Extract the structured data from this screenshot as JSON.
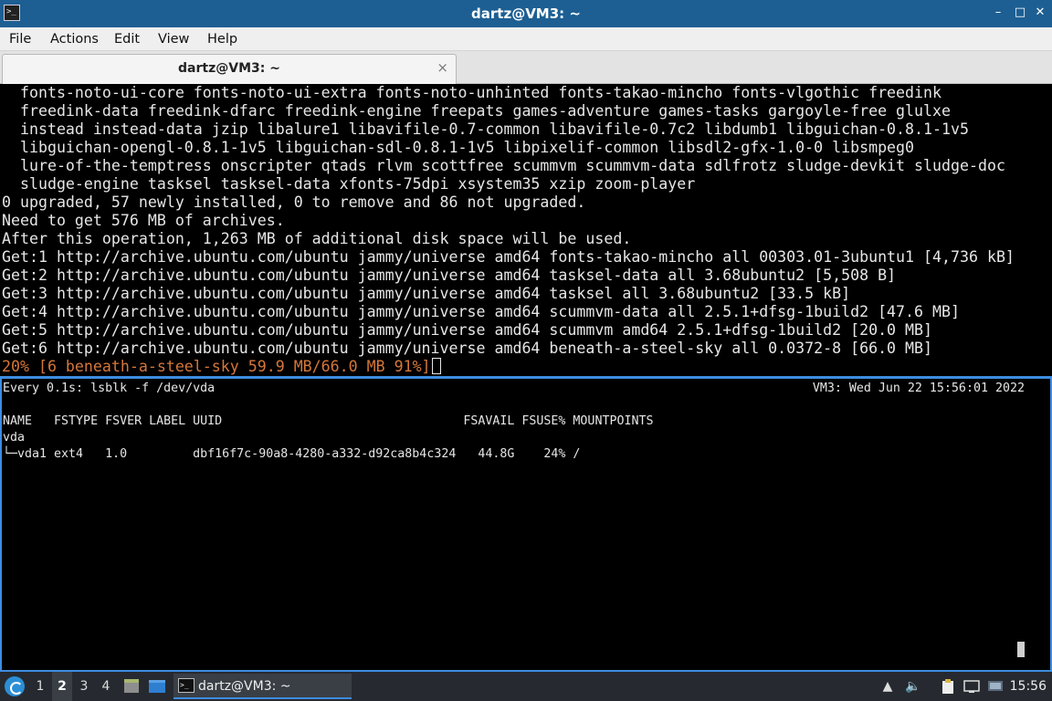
{
  "window": {
    "title": "dartz@VM3: ~",
    "minimize_glyph": "–",
    "maximize_glyph": "□",
    "close_glyph": "✕"
  },
  "menu": [
    "File",
    "Actions",
    "Edit",
    "View",
    "Help"
  ],
  "tab": {
    "label": "dartz@VM3: ~",
    "close_glyph": "×"
  },
  "terminal_top": {
    "lines": [
      "  fonts-noto-ui-core fonts-noto-ui-extra fonts-noto-unhinted fonts-takao-mincho fonts-vlgothic freedink",
      "  freedink-data freedink-dfarc freedink-engine freepats games-adventure games-tasks gargoyle-free glulxe",
      "  instead instead-data jzip libalure1 libavifile-0.7-common libavifile-0.7c2 libdumb1 libguichan-0.8.1-1v5",
      "  libguichan-opengl-0.8.1-1v5 libguichan-sdl-0.8.1-1v5 libpixelif-common libsdl2-gfx-1.0-0 libsmpeg0",
      "  lure-of-the-temptress onscripter qtads rlvm scottfree scummvm scummvm-data sdlfrotz sludge-devkit sludge-doc",
      "  sludge-engine tasksel tasksel-data xfonts-75dpi xsystem35 xzip zoom-player",
      "0 upgraded, 57 newly installed, 0 to remove and 86 not upgraded.",
      "Need to get 576 MB of archives.",
      "After this operation, 1,263 MB of additional disk space will be used.",
      "Get:1 http://archive.ubuntu.com/ubuntu jammy/universe amd64 fonts-takao-mincho all 00303.01-3ubuntu1 [4,736 kB]",
      "Get:2 http://archive.ubuntu.com/ubuntu jammy/universe amd64 tasksel-data all 3.68ubuntu2 [5,508 B]",
      "Get:3 http://archive.ubuntu.com/ubuntu jammy/universe amd64 tasksel all 3.68ubuntu2 [33.5 kB]",
      "Get:4 http://archive.ubuntu.com/ubuntu jammy/universe amd64 scummvm-data all 2.5.1+dfsg-1build2 [47.6 MB]",
      "Get:5 http://archive.ubuntu.com/ubuntu jammy/universe amd64 scummvm amd64 2.5.1+dfsg-1build2 [20.0 MB]",
      "Get:6 http://archive.ubuntu.com/ubuntu jammy/universe amd64 beneath-a-steel-sky all 0.0372-8 [66.0 MB]"
    ],
    "progress_line": "20% [6 beneath-a-steel-sky 59.9 MB/66.0 MB 91%]"
  },
  "terminal_bottom": {
    "watch_header_left": "Every 0.1s: lsblk -f /dev/vda",
    "watch_header_right": "VM3: Wed Jun 22 15:56:01 2022",
    "table_header": "NAME   FSTYPE FSVER LABEL UUID                                 FSAVAIL FSUSE% MOUNTPOINTS",
    "rows": [
      "vda",
      "└─vda1 ext4   1.0         dbf16f7c-90a8-4280-a332-d92ca8b4c324   44.8G    24% /"
    ]
  },
  "taskbar": {
    "workspaces": [
      "1",
      "2",
      "3",
      "4"
    ],
    "active_workspace": "2",
    "task_label": "dartz@VM3: ~",
    "clock": "15:56"
  }
}
